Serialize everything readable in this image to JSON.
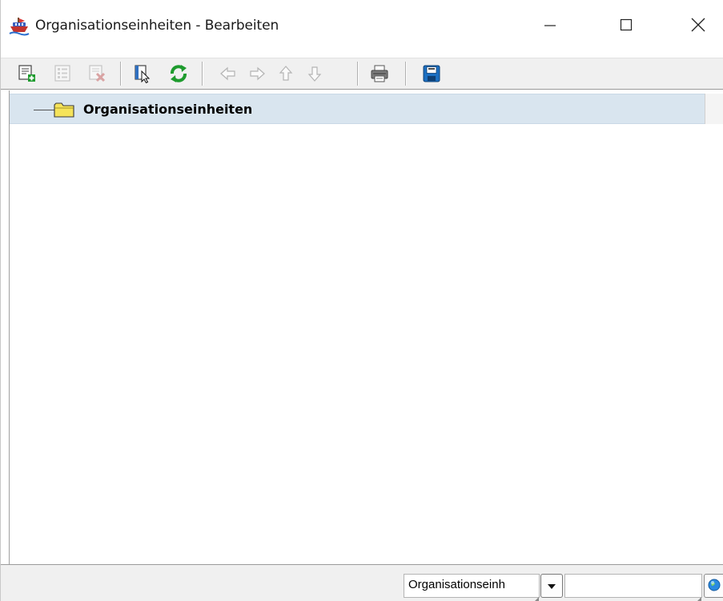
{
  "window": {
    "title": "Organisationseinheiten - Bearbeiten",
    "icon": "ship-app-icon",
    "controls": [
      {
        "name": "minimize-button",
        "icon": "minimize-icon"
      },
      {
        "name": "maximize-button",
        "icon": "maximize-icon"
      },
      {
        "name": "close-button",
        "icon": "close-icon"
      }
    ]
  },
  "toolbar": {
    "buttons": [
      {
        "name": "new-button",
        "icon": "new-record-icon",
        "enabled": true
      },
      {
        "name": "edit-button",
        "icon": "edit-record-icon",
        "enabled": false
      },
      {
        "name": "delete-button",
        "icon": "delete-record-icon",
        "enabled": false
      },
      {
        "name": "select-button",
        "icon": "select-cursor-icon",
        "enabled": true
      },
      {
        "name": "refresh-button",
        "icon": "refresh-icon",
        "enabled": true
      },
      {
        "name": "move-left-button",
        "icon": "arrow-left-icon",
        "enabled": false
      },
      {
        "name": "move-right-button",
        "icon": "arrow-right-icon",
        "enabled": false
      },
      {
        "name": "move-up-button",
        "icon": "arrow-up-icon",
        "enabled": false
      },
      {
        "name": "move-down-button",
        "icon": "arrow-down-icon",
        "enabled": false
      },
      {
        "name": "print-button",
        "icon": "printer-icon",
        "enabled": true
      },
      {
        "name": "save-button",
        "icon": "save-icon",
        "enabled": true
      }
    ]
  },
  "tree": {
    "root": {
      "label": "Organisationseinheiten",
      "icon": "folder-icon",
      "selected": true
    }
  },
  "statusbar": {
    "combo_value": "Organisationseinh",
    "search_value": "",
    "globe_icon": "globe-icon"
  },
  "colors": {
    "selection": "#d9e5ef",
    "folder": "#f5e35a",
    "refresh": "#1e9b2e",
    "save": "#1b6fc2",
    "disabled": "#b8b8b8"
  }
}
